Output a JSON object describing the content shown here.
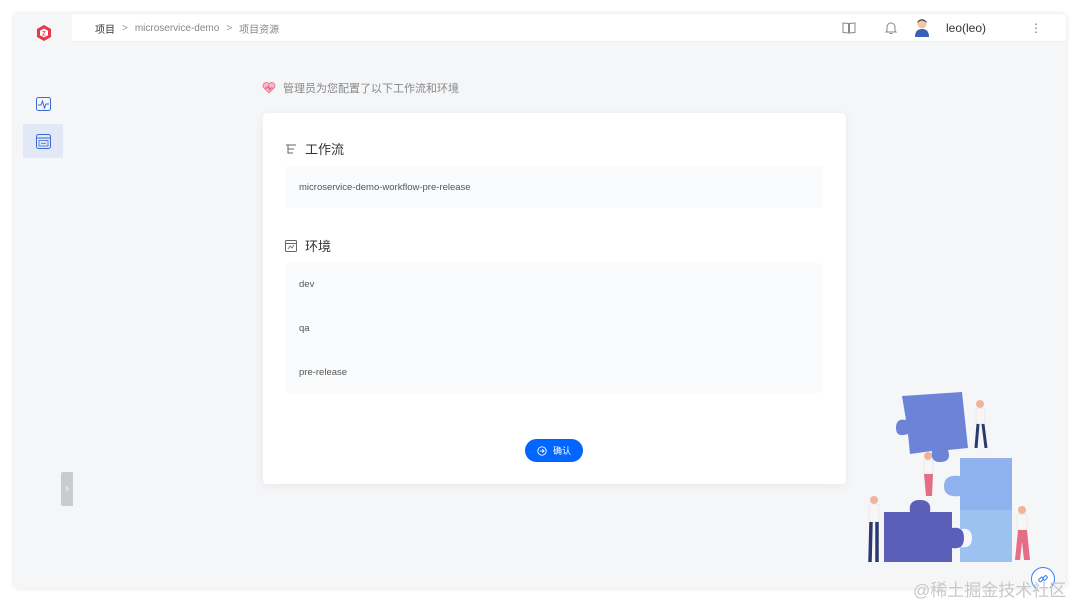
{
  "breadcrumb": {
    "root": "项目",
    "project": "microservice-demo",
    "current": "项目资源",
    "separator": ">"
  },
  "header": {
    "username": "leo(leo)",
    "more": "⋮"
  },
  "notice": "管理员为您配置了以下工作流和环境",
  "workflow_section": {
    "title": "工作流",
    "items": [
      "microservice-demo-workflow-pre-release"
    ]
  },
  "env_section": {
    "title": "环境",
    "items": [
      "dev",
      "qa",
      "pre-release"
    ]
  },
  "confirm_label": "确认",
  "sidebar": {
    "collapse_glyph": "›"
  },
  "watermark": "@稀土掘金技术社区",
  "colors": {
    "primary": "#0066ff",
    "logo": "#e8364b",
    "active_bg": "#e3e8f7"
  }
}
